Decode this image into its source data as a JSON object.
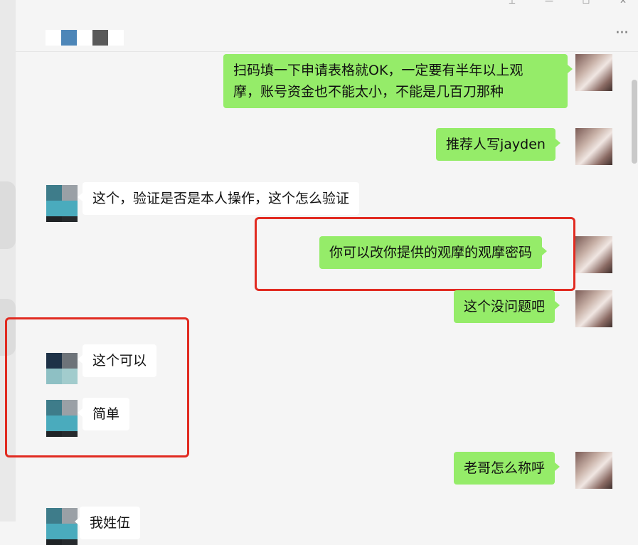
{
  "window_controls": {
    "pin_glyph": "⊥",
    "minimize_glyph": "—",
    "maximize_glyph": "☐",
    "close_glyph": "✕"
  },
  "header": {
    "more_glyph": "···"
  },
  "messages": [
    {
      "id": "m1",
      "from": "me",
      "text": "扫码填一下申请表格就OK，一定要有半年以上观\n摩，账号资金也不能太小，不能是几百刀那种"
    },
    {
      "id": "m2",
      "from": "me",
      "text": "推荐人写jayden"
    },
    {
      "id": "m3",
      "from": "them",
      "text": "这个，验证是否是本人操作，这个怎么验证"
    },
    {
      "id": "m4",
      "from": "me",
      "text": "你可以改你提供的观摩的观摩密码"
    },
    {
      "id": "m5",
      "from": "me",
      "text": "这个没问题吧"
    },
    {
      "id": "m6",
      "from": "them",
      "text": "这个可以"
    },
    {
      "id": "m7",
      "from": "them",
      "text": "简单"
    },
    {
      "id": "m8",
      "from": "me",
      "text": "老哥怎么称呼"
    },
    {
      "id": "m9",
      "from": "them",
      "text": "我姓伍"
    }
  ],
  "colors": {
    "my_bubble": "#95ec69",
    "their_bubble": "#ffffff",
    "highlight_box": "#e12b21",
    "background": "#f5f5f5"
  }
}
